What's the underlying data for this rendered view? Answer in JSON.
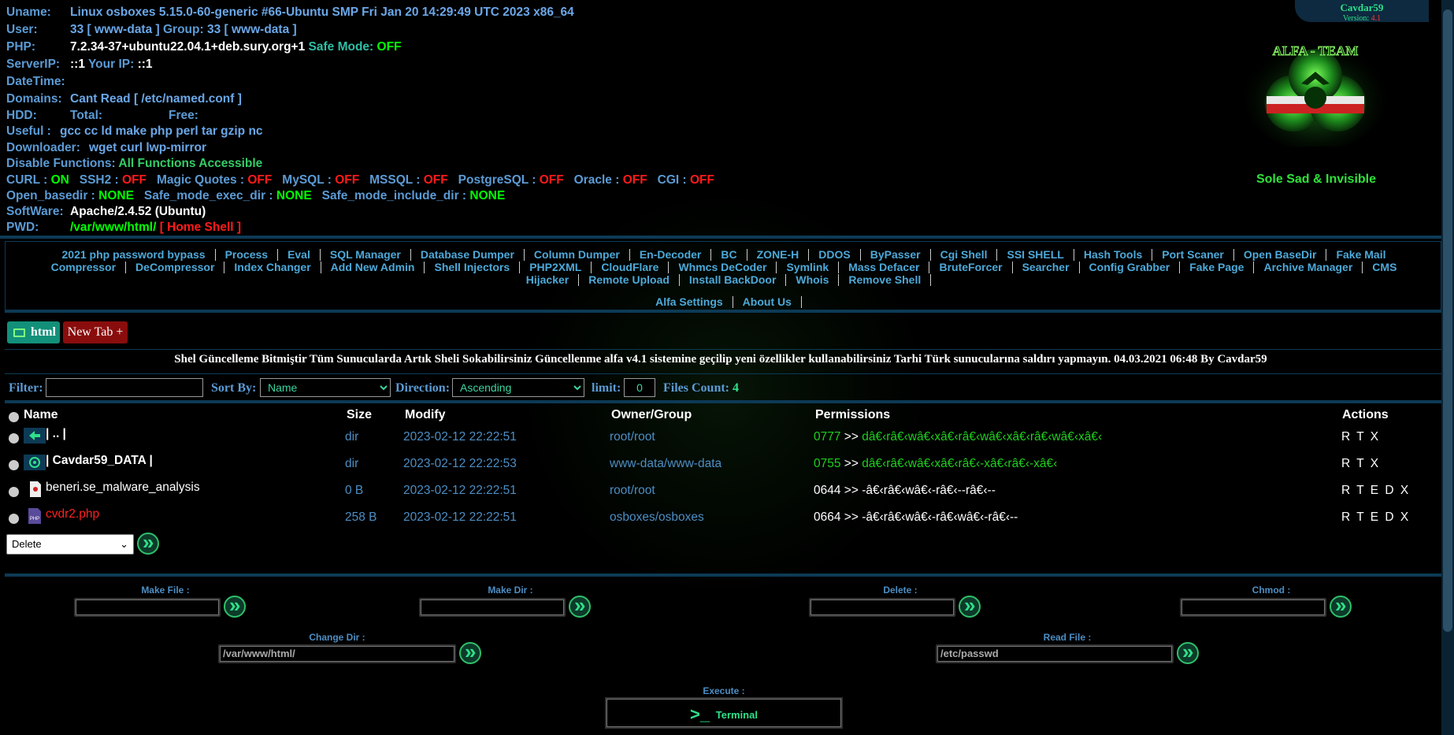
{
  "header": {
    "uname_label": "Uname:",
    "uname_value": "Linux osboxes 5.15.0-60-generic #66-Ubuntu SMP Fri Jan 20 14:29:49 UTC 2023 x86_64",
    "user_label": "User:",
    "user_value": "33 [ www-data ]",
    "group_label": "Group:",
    "group_value": "33 [ www-data ]",
    "php_label": "PHP:",
    "php_value": "7.2.34-37+ubuntu22.04.1+deb.sury.org+1",
    "safe_mode_label": "Safe Mode:",
    "safe_mode_value": "OFF",
    "serverip_label": "ServerIP:",
    "serverip_value": "::1",
    "yourip_label": "Your IP:",
    "yourip_value": "::1",
    "datetime_label": "DateTime:",
    "domains_label": "Domains:",
    "domains_value": "Cant Read [ /etc/named.conf ]",
    "hdd_label": "HDD:",
    "hdd_total_label": "Total:",
    "hdd_free_label": "Free:",
    "useful_label": "Useful :",
    "useful_value": "gcc cc ld make php perl tar gzip nc",
    "downloader_label": "Downloader:",
    "downloader_value": "wget curl lwp-mirror",
    "disable_label": "Disable Functions:",
    "disable_value": "All Functions Accessible",
    "features": [
      {
        "name": "CURL :",
        "value": "ON",
        "on": true
      },
      {
        "name": "SSH2 :",
        "value": "OFF",
        "on": false
      },
      {
        "name": "Magic Quotes :",
        "value": "OFF",
        "on": false
      },
      {
        "name": "MySQL :",
        "value": "OFF",
        "on": false
      },
      {
        "name": "MSSQL :",
        "value": "OFF",
        "on": false
      },
      {
        "name": "PostgreSQL :",
        "value": "OFF",
        "on": false
      },
      {
        "name": "Oracle :",
        "value": "OFF",
        "on": false
      },
      {
        "name": "CGI :",
        "value": "OFF",
        "on": false
      }
    ],
    "open_basedir_label": "Open_basedir :",
    "open_basedir_value": "NONE",
    "safe_exec_label": "Safe_mode_exec_dir :",
    "safe_exec_value": "NONE",
    "safe_include_label": "Safe_mode_include_dir :",
    "safe_include_value": "NONE",
    "software_label": "SoftWare:",
    "software_value": "Apache/2.4.52 (Ubuntu)",
    "pwd_label": "PWD:",
    "pwd_value": "/var/www/html/",
    "pwd_home": "[ Home Shell ]",
    "author": "Cavdar59",
    "version_label": "Version:",
    "version_value": "4.1",
    "logo_text": "ALFA - TEAM",
    "tagline": "Sole Sad & Invisible"
  },
  "nav": {
    "line1": [
      "2021 php password bypass",
      "Process",
      "Eval",
      "SQL Manager",
      "Database Dumper",
      "Column Dumper",
      "En-Decoder",
      "BC",
      "ZONE-H",
      "DDOS",
      "ByPasser",
      "Cgi Shell",
      "SSI SHELL",
      "Hash Tools",
      "Port Scaner",
      "Open BaseDir",
      "Fake Mail"
    ],
    "line2": [
      "Compressor",
      "DeCompressor",
      "Index Changer",
      "Add New Admin",
      "Shell Injectors",
      "PHP2XML",
      "CloudFlare",
      "Whmcs DeCoder",
      "Symlink",
      "Mass Defacer",
      "BruteForcer",
      "Searcher",
      "Config Grabber",
      "Fake Page",
      "Archive Manager",
      "CMS"
    ],
    "line3": [
      "Hijacker",
      "Remote Upload",
      "Install BackDoor",
      "Whois",
      "Remove Shell"
    ],
    "line4": [
      "Alfa Settings",
      "About Us"
    ]
  },
  "tabs": {
    "current": "html",
    "new_tab": "New Tab +"
  },
  "notice": "Shel Güncelleme Bitmiştir Tüm Sunucularda Artık Sheli Sokabilirsiniz Güncellenme alfa v4.1 sistemine geçilip yeni özellikler kullanabilirsiniz Tarhi Türk sunucularına saldırı yapmayın. 04.03.2021 06:48 By Cavdar59",
  "filter": {
    "filter_label": "Filter:",
    "filter_value": "",
    "sort_label": "Sort By:",
    "sort_value": "Name",
    "direction_label": "Direction:",
    "direction_value": "Ascending",
    "limit_label": "limit:",
    "limit_value": "0",
    "count_label": "Files Count:",
    "count_value": "4"
  },
  "table": {
    "headers": {
      "name": "Name",
      "size": "Size",
      "modify": "Modify",
      "owner": "Owner/Group",
      "perms": "Permissions",
      "actions": "Actions"
    },
    "rows": [
      {
        "name": "| .. |",
        "size": "dir",
        "modify": "2023-02-12 22:22:51",
        "owner": "root/root",
        "perm_num": "0777",
        "perm_arrows": ">>",
        "perm_str": "dâ€‹râ€‹wâ€‹xâ€‹râ€‹wâ€‹xâ€‹râ€‹wâ€‹xâ€‹",
        "actions": "R T X",
        "icon": "back-arrow-icon"
      },
      {
        "name": "| Cavdar59_DATA |",
        "size": "dir",
        "modify": "2023-02-12 22:22:53",
        "owner": "www-data/www-data",
        "perm_num": "0755",
        "perm_arrows": ">>",
        "perm_str": "dâ€‹râ€‹wâ€‹xâ€‹râ€‹-xâ€‹râ€‹-xâ€‹",
        "actions": "R T X",
        "icon": "biohazard-folder-icon"
      },
      {
        "name": "beneri.se_malware_analysis",
        "size": "0 B",
        "modify": "2023-02-12 22:22:51",
        "owner": "root/root",
        "perm_num": "0644",
        "perm_arrows": ">>",
        "perm_str": "-â€‹râ€‹wâ€‹-râ€‹--râ€‹--",
        "actions": "R T E D X",
        "icon": "file-icon"
      },
      {
        "name": "cvdr2.php",
        "size": "258 B",
        "modify": "2023-02-12 22:22:51",
        "owner": "osboxes/osboxes",
        "perm_num": "0664",
        "perm_arrows": ">>",
        "perm_str": "-â€‹râ€‹wâ€‹-râ€‹wâ€‹-râ€‹--",
        "actions": "R T E D X",
        "icon": "php-file-icon"
      }
    ],
    "bulk_action": "Delete"
  },
  "tools": {
    "make_file": "Make File :",
    "make_dir": "Make Dir :",
    "delete": "Delete :",
    "chmod": "Chmod :",
    "change_dir": "Change Dir :",
    "change_dir_value": "/var/www/html/",
    "read_file": "Read File :",
    "read_file_value": "/etc/passwd",
    "execute": "Execute :",
    "terminal": "Terminal",
    "terminal_prompt": ">_"
  },
  "colors": {
    "accent": "#0d3a55",
    "link": "#4da9d9",
    "on": "#00ff00",
    "off": "#ff1a1a"
  }
}
